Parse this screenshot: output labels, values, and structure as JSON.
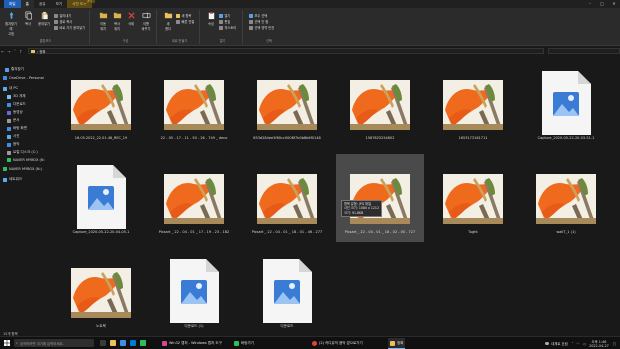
{
  "tabs": {
    "file": "파일",
    "manage": "관리",
    "home": "홈",
    "share": "공유",
    "view": "보기",
    "picture_tools": "사진 도구"
  },
  "ribbon": {
    "pin": "즐겨찾기에\n고정",
    "copy": "복사",
    "paste": "붙여넣기",
    "cut": "잘라내기",
    "copy_path": "경로 복사",
    "paste_shortcut": "바로 가기 붙여넣기",
    "clipboard_label": "클립보드",
    "move_to": "이동\n위치",
    "copy_to": "복사\n위치",
    "delete": "삭제",
    "rename": "이름\n바꾸기",
    "organize_label": "구성",
    "new_folder": "새\n폴더",
    "new_item": "새 항목",
    "easy_access": "빠른 연결",
    "new_label": "새로 만들기",
    "properties": "속성",
    "open": "열기",
    "edit": "편집",
    "history": "히스토리",
    "open_label": "열기",
    "select_all": "모두 선택",
    "select_none": "선택 안 함",
    "invert_selection": "선택 영역 반전",
    "select_label": "선택"
  },
  "address": {
    "path": "› 정확"
  },
  "nav": {
    "items": [
      "즐겨찾기",
      "OneDrive - Personal",
      "내 PC",
      "3D 개체",
      "다운로드",
      "동영상",
      "문서",
      "바탕 화면",
      "사진",
      "음악",
      "로컬 디스크 (C:)",
      "NAVER MYBOX (N:",
      "NAVER MYBOX (N:)",
      "네트워크"
    ]
  },
  "files": [
    {
      "name": "16.05.2022_22.01.46_REC_19",
      "type": "image"
    },
    {
      "name": "22 - 05 - 17 - 11 - 50 - 26 - 749 _ deco",
      "type": "image"
    },
    {
      "name": "853d284ee3f60cc0008f7b0b8b6f0148",
      "type": "image"
    },
    {
      "name": "1587625254602",
      "type": "image"
    },
    {
      "name": "1653173161711",
      "type": "image"
    },
    {
      "name": "Capture_2020-05-22-20-03-51-1",
      "type": "doc"
    },
    {
      "name": "Capture_2020-05-22-20-04-05-1",
      "type": "doc"
    },
    {
      "name": "Picsart _ 22 - 04 - 01 _ 17 - 19 - 23 - 182",
      "type": "image"
    },
    {
      "name": "Picsart _ 22 - 04 - 01 _ 18 - 01 - 46 - 277",
      "type": "image"
    },
    {
      "name": "Picsart _ 22 - 04 - 01 _ 18 - 02 - 00 - 727",
      "type": "image"
    },
    {
      "name": "Tught",
      "type": "image"
    },
    {
      "name": "wallT_1 (1)",
      "type": "image"
    },
    {
      "name": "노트북",
      "type": "image"
    },
    {
      "name": "다운로드 (1)",
      "type": "doc"
    },
    {
      "name": "다운로드",
      "type": "doc"
    }
  ],
  "tooltip": {
    "line1": "항목 유형: JPG 파일",
    "line2": "사진 크기: 1080 x 1212",
    "line3": "크기: 91.8KB"
  },
  "status": {
    "count": "15개 항목"
  },
  "taskbar": {
    "search_placeholder": "검색하려면 여기에 입력하세요.",
    "app1": "Win32 캡처 - Windows 캡처 도구",
    "app2": "바탕가기",
    "app3": "(2) 카디뮤직 음악 앞으로가기",
    "app4": "정확",
    "weather": "대체로 흐림",
    "time": "오후 1:46",
    "date": "2022-04-27"
  },
  "colors": {
    "accent": "#1f5fb5",
    "manage_tab": "#5c4a12",
    "selected_tile": "#4a4a4a",
    "orange_paint": "#f06a1e",
    "brush_green": "#6c8a3c"
  }
}
